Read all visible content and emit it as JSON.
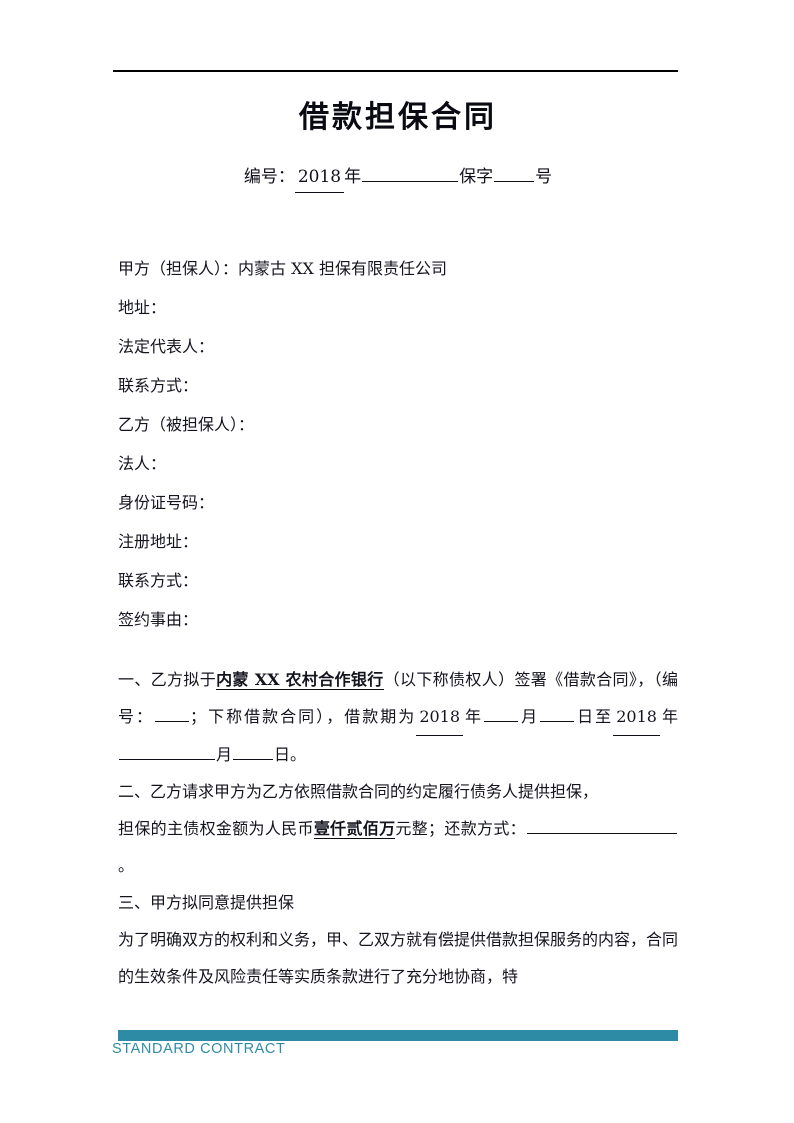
{
  "document": {
    "title": "借款担保合同",
    "subtitle": {
      "label_prefix": "编号：",
      "year_value": "2018",
      "year_unit": "年",
      "mid_label": "保字",
      "suffix": "号"
    }
  },
  "parties": [
    {
      "label": "甲方（担保人）：内蒙古 XX 担保有限责任公司"
    },
    {
      "label": "地址："
    },
    {
      "label": "法定代表人："
    },
    {
      "label": "联系方式："
    },
    {
      "label": "乙方（被担保人）："
    },
    {
      "label": "法人："
    },
    {
      "label": "身份证号码："
    },
    {
      "label": "注册地址："
    },
    {
      "label": "联系方式："
    },
    {
      "label": "签约事由："
    }
  ],
  "clauses": {
    "one": {
      "lead": "一、乙方拟于",
      "bank_name": "内蒙 XX 农村合作银行",
      "after_bank": "（以下称债权人）签署《借款合同》，（编号：",
      "after_code": "；下称借款合同），借款期为",
      "start_year": "2018",
      "year_unit": "年",
      "month_unit": "月",
      "day_unit": "日",
      "to_word": "至",
      "end_year": "2018",
      "end_period": "。"
    },
    "two": {
      "line1": "二、乙方请求甲方为乙方依照借款合同的约定履行债务人提供担保，",
      "line2_pre": "担保的主债权金额为人民币",
      "amount": "壹仟贰佰万",
      "line2_post": "元整；还款方式：",
      "line2_end": "。"
    },
    "three": {
      "heading": "三、甲方拟同意提供担保",
      "body": "为了明确双方的权利和义务，甲、乙双方就有偿提供借款担保服务的内容，合同的生效条件及风险责任等实质条款进行了充分地协商，特"
    }
  },
  "footer": {
    "label": "STANDARD CONTRACT",
    "accent_color": "#2e8ba5"
  }
}
